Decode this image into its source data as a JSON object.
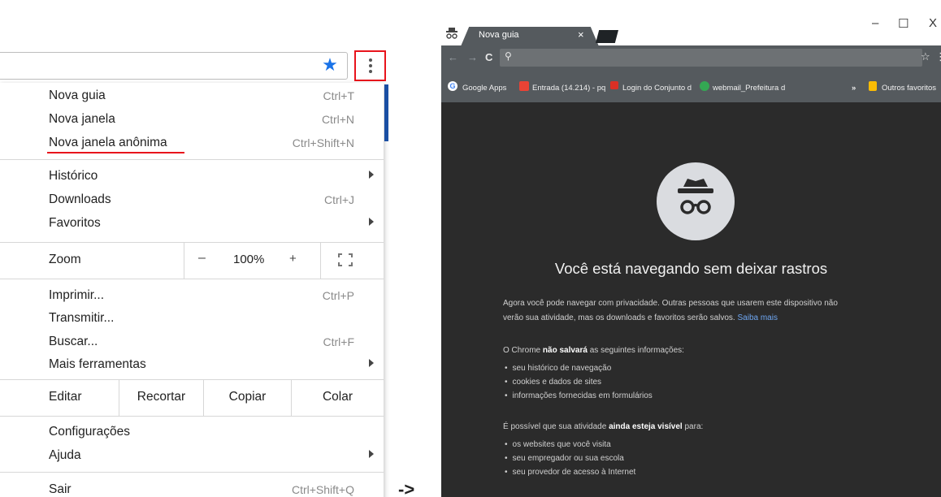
{
  "menu": {
    "items": [
      {
        "label": "Nova guia",
        "shortcut": "Ctrl+T"
      },
      {
        "label": "Nova janela",
        "shortcut": "Ctrl+N"
      },
      {
        "label": "Nova janela anônima",
        "shortcut": "Ctrl+Shift+N"
      },
      {
        "label": "Histórico",
        "shortcut": ""
      },
      {
        "label": "Downloads",
        "shortcut": "Ctrl+J"
      },
      {
        "label": "Favoritos",
        "shortcut": ""
      },
      {
        "label": "Imprimir...",
        "shortcut": "Ctrl+P"
      },
      {
        "label": "Transmitir...",
        "shortcut": ""
      },
      {
        "label": "Buscar...",
        "shortcut": "Ctrl+F"
      },
      {
        "label": "Mais ferramentas",
        "shortcut": ""
      },
      {
        "label": "Configurações",
        "shortcut": ""
      },
      {
        "label": "Ajuda",
        "shortcut": ""
      },
      {
        "label": "Sair",
        "shortcut": "Ctrl+Shift+Q"
      }
    ],
    "zoom": {
      "label": "Zoom",
      "minus": "–",
      "value": "100%",
      "plus": "+"
    },
    "edit": {
      "label": "Editar",
      "cut": "Recortar",
      "copy": "Copiar",
      "paste": "Colar"
    },
    "accent_color": "#e8141c",
    "star_color": "#1a73e8"
  },
  "arrow_text": "->",
  "incognito_window": {
    "tab_title": "Nova guia",
    "tab_close": "×",
    "window_controls": {
      "minimize": "–",
      "maximize": "☐",
      "close": "X"
    },
    "nav": {
      "back": "←",
      "forward": "→",
      "reload": "C"
    },
    "bookmarks": [
      {
        "label": "Google Apps",
        "icon": "google-icon"
      },
      {
        "label": "Entrada (14.214) - pq",
        "icon": "gmail-icon"
      },
      {
        "label": "Login do Conjunto d",
        "icon": "login-icon"
      },
      {
        "label": "webmail_Prefeitura d",
        "icon": "webmail-icon"
      }
    ],
    "bookmarks_overflow": "»",
    "other_bookmarks": "Outros favoritos",
    "heading": "Você está navegando sem deixar rastros",
    "intro_line1": "Agora você pode navegar com privacidade. Outras pessoas que usarem este dispositivo não",
    "intro_line2": "verão sua atividade, mas os downloads e favoritos serão salvos.",
    "learn_more": "Saiba mais",
    "wont_save_prefix": "O Chrome",
    "wont_save_bold": "não salvará",
    "wont_save_suffix": "as seguintes informações:",
    "wont_save_items": [
      "seu histórico de navegação",
      "cookies e dados de sites",
      "informações fornecidas em formulários"
    ],
    "visible_prefix": "É possível que sua atividade",
    "visible_bold": "ainda esteja visível",
    "visible_suffix": "para:",
    "visible_items": [
      "os websites que você visita",
      "seu empregador ou sua escola",
      "seu provedor de acesso à Internet"
    ],
    "background_color": "#2b2b2b",
    "toolbar_color": "#555a5e",
    "link_color": "#6ea6f1"
  }
}
